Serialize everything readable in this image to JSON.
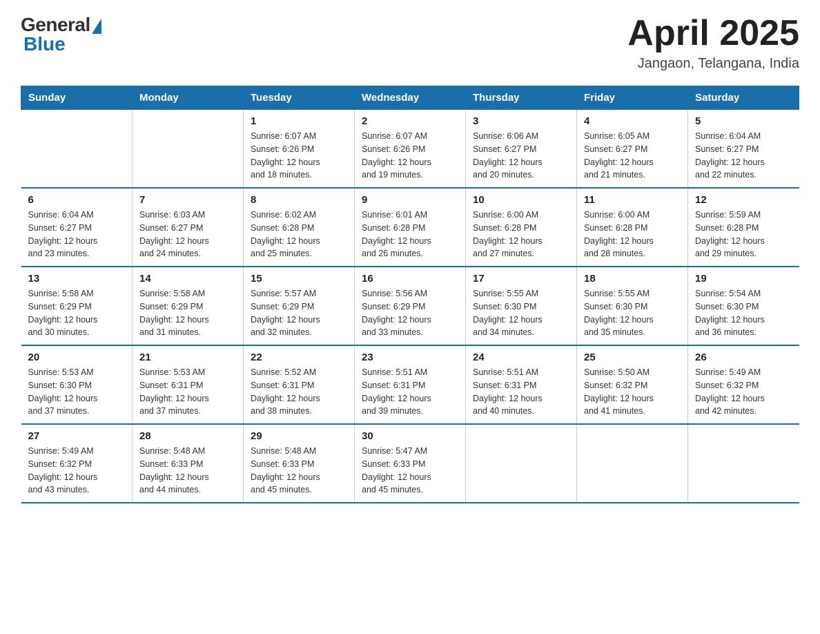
{
  "header": {
    "logo_general": "General",
    "logo_blue": "Blue",
    "month_year": "April 2025",
    "location": "Jangaon, Telangana, India"
  },
  "columns": [
    "Sunday",
    "Monday",
    "Tuesday",
    "Wednesday",
    "Thursday",
    "Friday",
    "Saturday"
  ],
  "weeks": [
    [
      {
        "day": "",
        "info": ""
      },
      {
        "day": "",
        "info": ""
      },
      {
        "day": "1",
        "info": "Sunrise: 6:07 AM\nSunset: 6:26 PM\nDaylight: 12 hours\nand 18 minutes."
      },
      {
        "day": "2",
        "info": "Sunrise: 6:07 AM\nSunset: 6:26 PM\nDaylight: 12 hours\nand 19 minutes."
      },
      {
        "day": "3",
        "info": "Sunrise: 6:06 AM\nSunset: 6:27 PM\nDaylight: 12 hours\nand 20 minutes."
      },
      {
        "day": "4",
        "info": "Sunrise: 6:05 AM\nSunset: 6:27 PM\nDaylight: 12 hours\nand 21 minutes."
      },
      {
        "day": "5",
        "info": "Sunrise: 6:04 AM\nSunset: 6:27 PM\nDaylight: 12 hours\nand 22 minutes."
      }
    ],
    [
      {
        "day": "6",
        "info": "Sunrise: 6:04 AM\nSunset: 6:27 PM\nDaylight: 12 hours\nand 23 minutes."
      },
      {
        "day": "7",
        "info": "Sunrise: 6:03 AM\nSunset: 6:27 PM\nDaylight: 12 hours\nand 24 minutes."
      },
      {
        "day": "8",
        "info": "Sunrise: 6:02 AM\nSunset: 6:28 PM\nDaylight: 12 hours\nand 25 minutes."
      },
      {
        "day": "9",
        "info": "Sunrise: 6:01 AM\nSunset: 6:28 PM\nDaylight: 12 hours\nand 26 minutes."
      },
      {
        "day": "10",
        "info": "Sunrise: 6:00 AM\nSunset: 6:28 PM\nDaylight: 12 hours\nand 27 minutes."
      },
      {
        "day": "11",
        "info": "Sunrise: 6:00 AM\nSunset: 6:28 PM\nDaylight: 12 hours\nand 28 minutes."
      },
      {
        "day": "12",
        "info": "Sunrise: 5:59 AM\nSunset: 6:28 PM\nDaylight: 12 hours\nand 29 minutes."
      }
    ],
    [
      {
        "day": "13",
        "info": "Sunrise: 5:58 AM\nSunset: 6:29 PM\nDaylight: 12 hours\nand 30 minutes."
      },
      {
        "day": "14",
        "info": "Sunrise: 5:58 AM\nSunset: 6:29 PM\nDaylight: 12 hours\nand 31 minutes."
      },
      {
        "day": "15",
        "info": "Sunrise: 5:57 AM\nSunset: 6:29 PM\nDaylight: 12 hours\nand 32 minutes."
      },
      {
        "day": "16",
        "info": "Sunrise: 5:56 AM\nSunset: 6:29 PM\nDaylight: 12 hours\nand 33 minutes."
      },
      {
        "day": "17",
        "info": "Sunrise: 5:55 AM\nSunset: 6:30 PM\nDaylight: 12 hours\nand 34 minutes."
      },
      {
        "day": "18",
        "info": "Sunrise: 5:55 AM\nSunset: 6:30 PM\nDaylight: 12 hours\nand 35 minutes."
      },
      {
        "day": "19",
        "info": "Sunrise: 5:54 AM\nSunset: 6:30 PM\nDaylight: 12 hours\nand 36 minutes."
      }
    ],
    [
      {
        "day": "20",
        "info": "Sunrise: 5:53 AM\nSunset: 6:30 PM\nDaylight: 12 hours\nand 37 minutes."
      },
      {
        "day": "21",
        "info": "Sunrise: 5:53 AM\nSunset: 6:31 PM\nDaylight: 12 hours\nand 37 minutes."
      },
      {
        "day": "22",
        "info": "Sunrise: 5:52 AM\nSunset: 6:31 PM\nDaylight: 12 hours\nand 38 minutes."
      },
      {
        "day": "23",
        "info": "Sunrise: 5:51 AM\nSunset: 6:31 PM\nDaylight: 12 hours\nand 39 minutes."
      },
      {
        "day": "24",
        "info": "Sunrise: 5:51 AM\nSunset: 6:31 PM\nDaylight: 12 hours\nand 40 minutes."
      },
      {
        "day": "25",
        "info": "Sunrise: 5:50 AM\nSunset: 6:32 PM\nDaylight: 12 hours\nand 41 minutes."
      },
      {
        "day": "26",
        "info": "Sunrise: 5:49 AM\nSunset: 6:32 PM\nDaylight: 12 hours\nand 42 minutes."
      }
    ],
    [
      {
        "day": "27",
        "info": "Sunrise: 5:49 AM\nSunset: 6:32 PM\nDaylight: 12 hours\nand 43 minutes."
      },
      {
        "day": "28",
        "info": "Sunrise: 5:48 AM\nSunset: 6:33 PM\nDaylight: 12 hours\nand 44 minutes."
      },
      {
        "day": "29",
        "info": "Sunrise: 5:48 AM\nSunset: 6:33 PM\nDaylight: 12 hours\nand 45 minutes."
      },
      {
        "day": "30",
        "info": "Sunrise: 5:47 AM\nSunset: 6:33 PM\nDaylight: 12 hours\nand 45 minutes."
      },
      {
        "day": "",
        "info": ""
      },
      {
        "day": "",
        "info": ""
      },
      {
        "day": "",
        "info": ""
      }
    ]
  ]
}
